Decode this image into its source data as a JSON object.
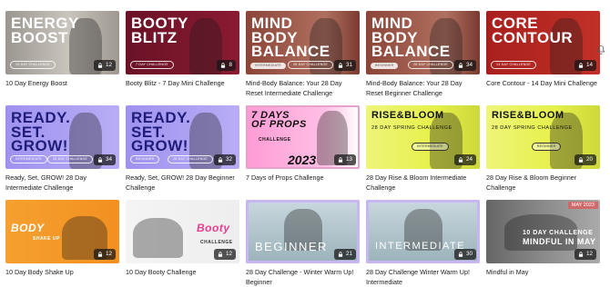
{
  "cards": [
    {
      "caption": "10 Day Energy Boost",
      "count": "12",
      "title_lines": [
        "ENERGY",
        "BOOST"
      ],
      "pill": "10 DAY CHALLENGE"
    },
    {
      "caption": "Booty Blitz - 7 Day Mini Challenge",
      "count": "8",
      "title_lines": [
        "BOOTY",
        "BLITZ"
      ],
      "pill": "7 DAY CHALLENGE"
    },
    {
      "caption": "Mind-Body Balance: Your 28 Day Reset Intermediate Challenge",
      "count": "31",
      "title_lines": [
        "MIND",
        "BODY",
        "BALANCE"
      ],
      "pill": "INTERMEDIATE",
      "pill2": "28 DAY CHALLENGE"
    },
    {
      "caption": "Mind-Body Balance: Your 28 Day Reset Beginner Challenge",
      "count": "34",
      "title_lines": [
        "MIND",
        "BODY",
        "BALANCE"
      ],
      "pill": "BEGINNER",
      "pill2": "28 DAY CHALLENGE"
    },
    {
      "caption": "Core Contour - 14 Day Mini Challenge",
      "count": "14",
      "title_lines": [
        "CORE",
        "CONTOUR"
      ],
      "pill": "14 DAY CHALLENGE"
    },
    {
      "caption": "Ready, Set, GROW! 28 Day Intermediate Challenge",
      "count": "34",
      "title_lines": [
        "READY.",
        "SET.",
        "GROW!"
      ],
      "pill": "INTERMEDIATE",
      "pill2": "28 DAY CHALLENGE"
    },
    {
      "caption": "Ready, Set, GROW! 28 Day Beginner Challenge",
      "count": "32",
      "title_lines": [
        "READY.",
        "SET.",
        "GROW!"
      ],
      "pill": "BEGINNER",
      "pill2": "28 DAY CHALLENGE"
    },
    {
      "caption": "7 Days of Props Challenge",
      "count": "13",
      "title_lines": [
        "7 DAYS",
        "OF PROPS"
      ],
      "sub": "CHALLENGE",
      "year": "2023"
    },
    {
      "caption": "28 Day Rise & Bloom Intermediate Challenge",
      "count": "24",
      "title_lines": [
        "RISE&BLOOM"
      ],
      "sub": "28 DAY SPRING CHALLENGE",
      "pill": "INTERMEDIATE"
    },
    {
      "caption": "28 Day Rise & Bloom Beginner Challenge",
      "count": "20",
      "title_lines": [
        "RISE&BLOOM"
      ],
      "sub": "28 DAY SPRING CHALLENGE",
      "pill": "BEGINNER"
    },
    {
      "caption": "10 Day Body Shake Up",
      "count": "12",
      "title_lines": [
        "BODY"
      ],
      "sub": "SHAKE UP"
    },
    {
      "caption": "10 Day Booty Challenge",
      "count": "12",
      "title_lines": [
        "Booty"
      ],
      "sub": "CHALLENGE"
    },
    {
      "caption": "28 Day Challenge - Winter Warm Up! Beginner",
      "count": "21",
      "title_lines": [
        "BEGINNER"
      ]
    },
    {
      "caption": "28 Day Challenge Winter Warm Up! Intermediate",
      "count": "30",
      "title_lines": [
        "INTERMEDIATE"
      ]
    },
    {
      "caption": "Mindful in May",
      "count": "12",
      "title_lines": [
        "10 DAY CHALLENGE",
        "MINDFUL IN MAY"
      ],
      "tag": "MAY 2023"
    }
  ],
  "colors": {
    "energy": "#b9b4ac",
    "booty": "#6a1226",
    "mind1": "#8b4538",
    "mind2": "#8b4538",
    "core": "#a8201d",
    "ready": "#a99cf0",
    "props_pink": "#ff9bd6",
    "rise": "#e6f04a",
    "body": "#f29020",
    "booty2": "#eeeeee",
    "winter": "#9bb2ba",
    "mindful": "#8a8a8a",
    "accent_pink": "#e83c8c"
  }
}
